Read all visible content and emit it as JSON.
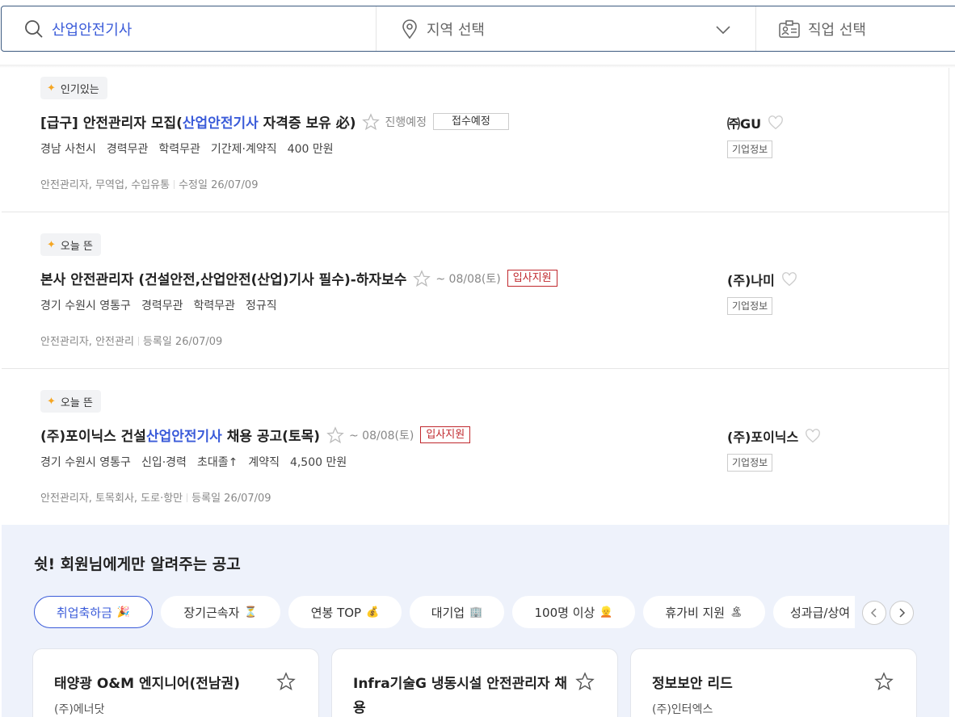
{
  "search": {
    "keyword": "산업안전기사",
    "region_label": "지역 선택",
    "job_label": "직업 선택"
  },
  "jobs": [
    {
      "badge": "인기있는",
      "title_pre": "[급구] 안전관리자 모집(",
      "title_hl": "산업안전기사",
      "title_post": " 자격증 보유 必)",
      "deadline": "진행예정",
      "tag": "접수예정",
      "meta": [
        "경남 사천시",
        "경력무관",
        "학력무관",
        "기간제·계약직",
        "400 만원"
      ],
      "footer_cats": "안전관리자, 무역업, 수입유통",
      "footer_date": "수정일 26/07/09",
      "company": "㈜GU",
      "company_info": "기업정보"
    },
    {
      "badge": "오늘 뜬",
      "title_pre": "본사 안전관리자 (건설안전,산업안전(산업)기사 필수)-하자보수",
      "title_hl": "",
      "title_post": "",
      "deadline": "~ 08/08(토)",
      "tag": "입사지원",
      "meta": [
        "경기 수원시 영통구",
        "경력무관",
        "학력무관",
        "정규직"
      ],
      "footer_cats": "안전관리자, 안전관리",
      "footer_date": "등록일 26/07/09",
      "company": "(주)나미",
      "company_info": "기업정보"
    },
    {
      "badge": "오늘 뜬",
      "title_pre": "(주)포이닉스 건설",
      "title_hl": "산업안전기사",
      "title_post": " 채용 공고(토목)",
      "deadline": "~ 08/08(토)",
      "tag": "입사지원",
      "meta": [
        "경기 수원시 영통구",
        "신입·경력",
        "초대졸↑",
        "계약직",
        "4,500 만원"
      ],
      "footer_cats": "안전관리자, 토목회사, 도로·항만",
      "footer_date": "등록일 26/07/09",
      "company": "(주)포이닉스",
      "company_info": "기업정보"
    }
  ],
  "member": {
    "heading": "쉿! 회원님에게만 알려주는 공고",
    "chips": [
      {
        "label": "취업축하금",
        "icon": "🎉"
      },
      {
        "label": "장기근속자",
        "icon": "⏳"
      },
      {
        "label": "연봉 TOP",
        "icon": "💰"
      },
      {
        "label": "대기업",
        "icon": "🏢"
      },
      {
        "label": "100명 이상",
        "icon": "👱"
      },
      {
        "label": "휴가비 지원",
        "icon": "🏝"
      },
      {
        "label": "성과급/상여",
        "icon": ""
      }
    ],
    "cards": [
      {
        "title": "태양광 O&M 엔지니어(전남권)",
        "company": "(주)에너닷"
      },
      {
        "title": "Infra기술G 냉동시설 안전관리자 채용",
        "company": ""
      },
      {
        "title": "정보보안 리드",
        "company": "(주)인터엑스"
      }
    ]
  }
}
